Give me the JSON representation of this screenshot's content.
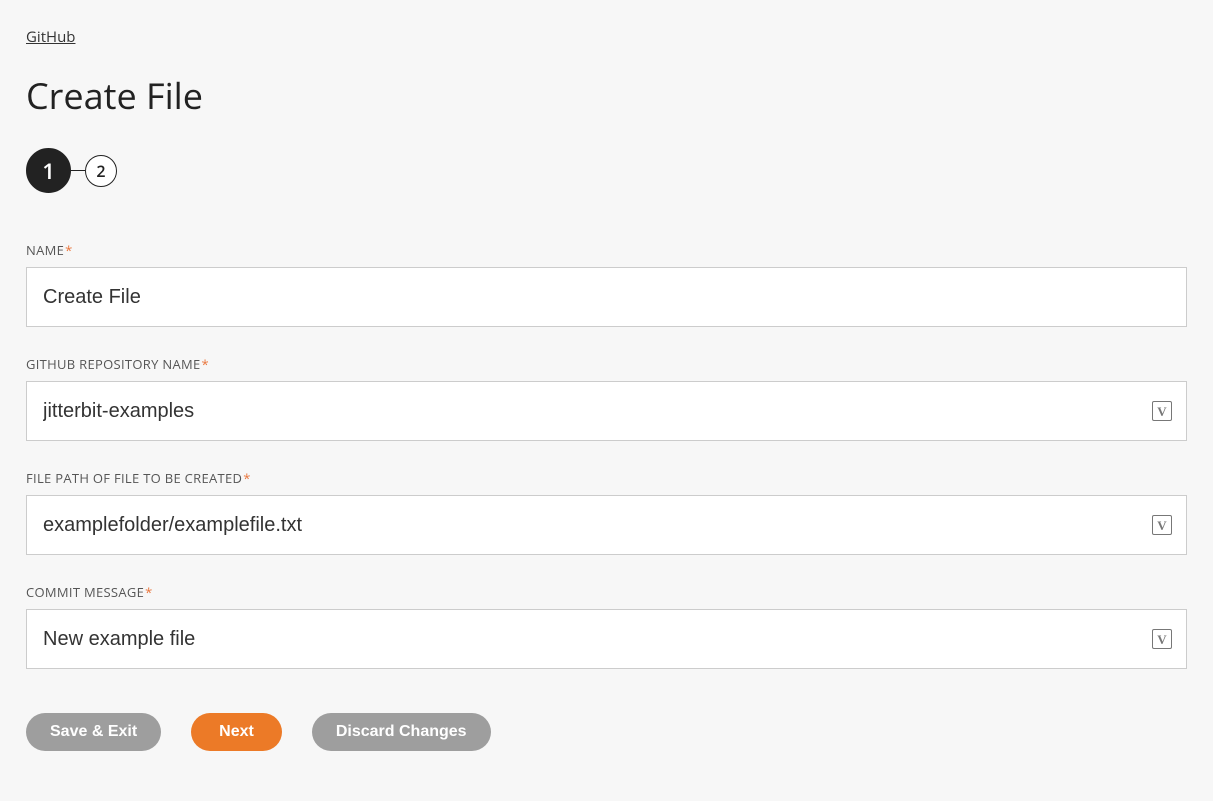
{
  "breadcrumb": "GitHub",
  "page_title": "Create File",
  "stepper": {
    "step1": "1",
    "step2": "2"
  },
  "fields": {
    "name": {
      "label": "NAME",
      "value": "Create File"
    },
    "repo": {
      "label": "GITHUB REPOSITORY NAME",
      "value": "jitterbit-examples"
    },
    "filepath": {
      "label": "FILE PATH OF FILE TO BE CREATED",
      "value": "examplefolder/examplefile.txt"
    },
    "commit": {
      "label": "COMMIT MESSAGE",
      "value": "New example file"
    }
  },
  "buttons": {
    "save_exit": "Save & Exit",
    "next": "Next",
    "discard": "Discard Changes"
  },
  "var_glyph": "V"
}
